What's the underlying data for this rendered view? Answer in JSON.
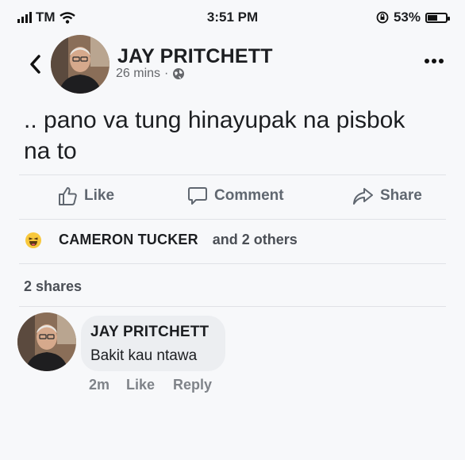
{
  "status_bar": {
    "carrier": "TM",
    "time": "3:51 PM",
    "battery": "53%",
    "battery_level": 0.53
  },
  "post": {
    "author": "JAY PRITCHETT",
    "timestamp": "26 mins",
    "separator": "·",
    "privacy_icon": "globe-icon",
    "text": ".. pano va tung hinayupak na pisbok na to"
  },
  "actions": {
    "like": "Like",
    "comment": "Comment",
    "share": "Share"
  },
  "reactions": {
    "reaction_icon": "haha-emoji-icon",
    "name": "CAMERON TUCKER",
    "others": "and 2 others"
  },
  "shares": "2 shares",
  "comment": {
    "author": "JAY PRITCHETT",
    "text": "Bakit kau ntawa",
    "time": "2m",
    "like": "Like",
    "reply": "Reply"
  },
  "colors": {
    "text": "#1c1e21",
    "muted": "#65676b",
    "bubble": "#eceef1",
    "background": "#f7f8fa"
  }
}
